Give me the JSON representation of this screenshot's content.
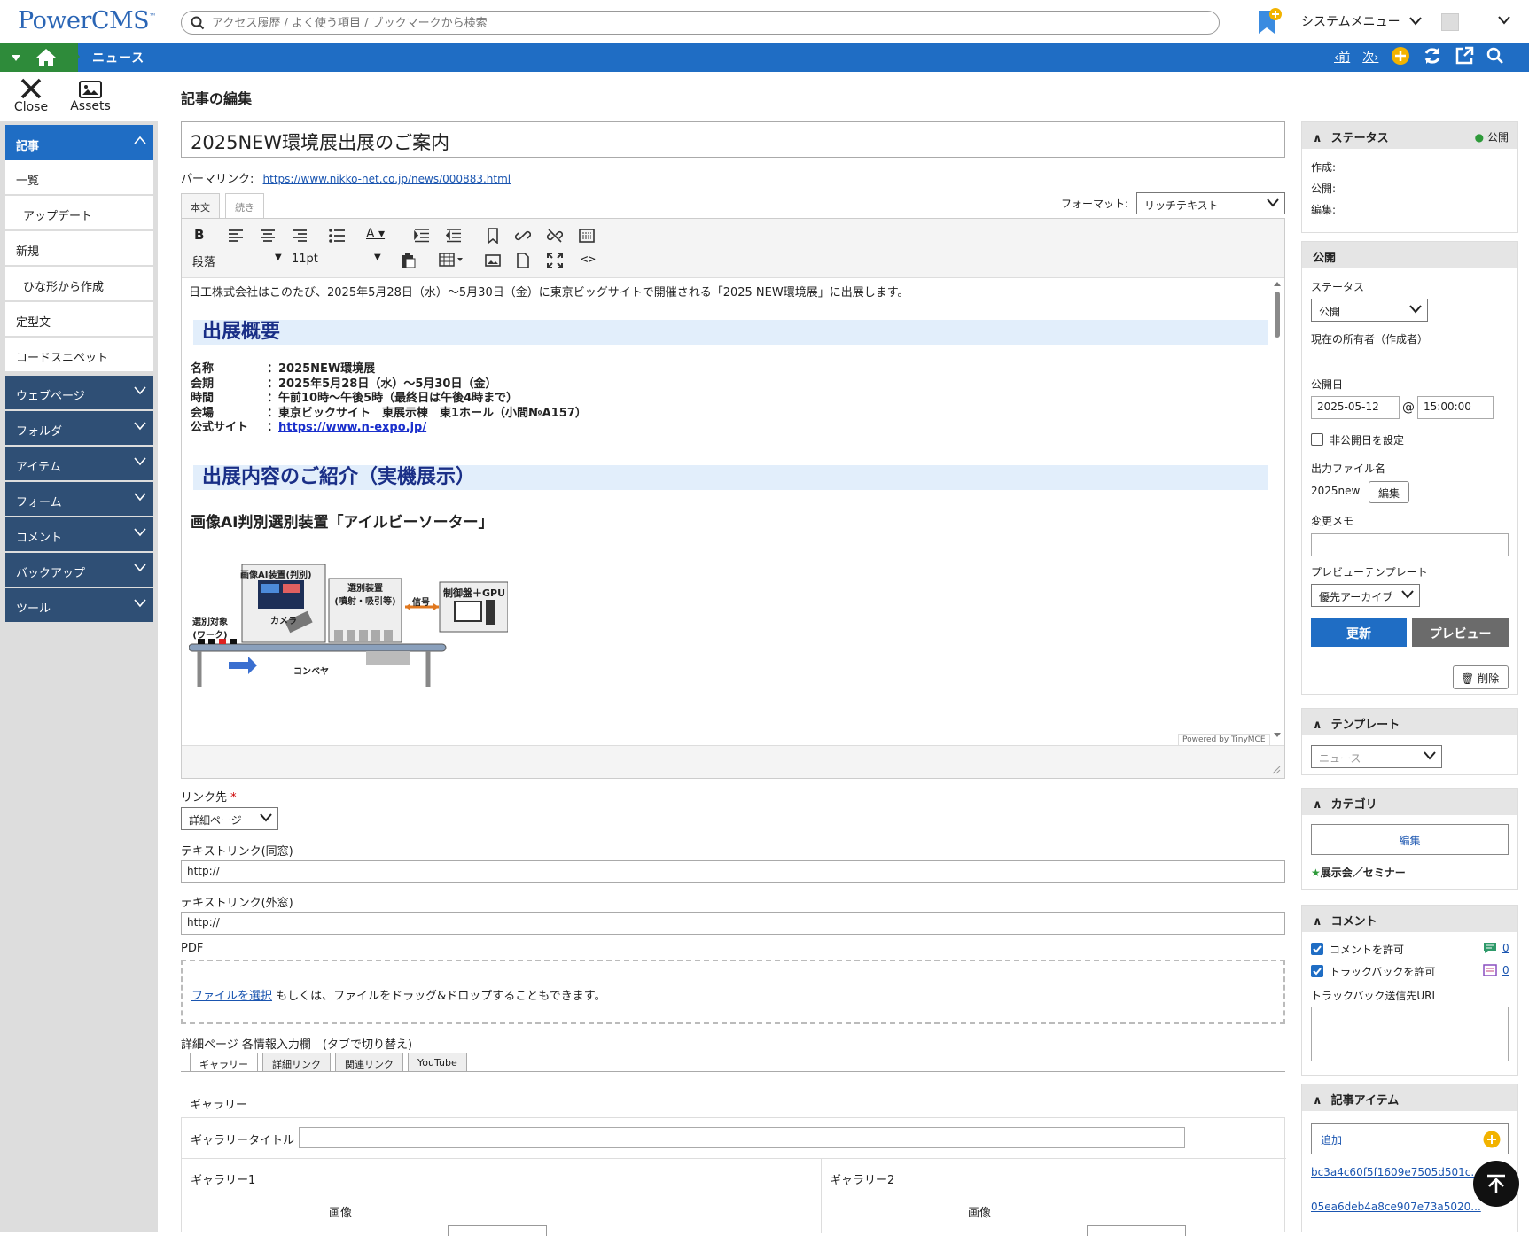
{
  "app": {
    "logo": "PowerCMS",
    "logo_tm": "™"
  },
  "search": {
    "placeholder": "アクセス履歴 / よく使う項目 / ブックマークから検索"
  },
  "header": {
    "system_menu": "システムメニュー"
  },
  "nav": {
    "breadcrumb": "ニュース",
    "prev": "‹前",
    "next": "次›"
  },
  "tools": {
    "close": "Close",
    "assets": "Assets"
  },
  "sidebar": {
    "active_section": "記事",
    "items": [
      "一覧",
      "アップデート",
      "新規",
      "ひな形から作成",
      "定型文",
      "コードスニペット"
    ],
    "sections": [
      "ウェブページ",
      "フォルダ",
      "アイテム",
      "フォーム",
      "コメント",
      "バックアップ",
      "ツール"
    ]
  },
  "page": {
    "title": "記事の編集"
  },
  "entry": {
    "title": "2025NEW環境展出展のご案内",
    "permalink_label": "パーマリンク:",
    "permalink": "https://www.nikko-net.co.jp/news/000883.html"
  },
  "editor": {
    "tabs": [
      "本文",
      "続き"
    ],
    "format_label": "フォーマット:",
    "format_value": "リッチテキスト",
    "block_select": "段落",
    "font_size": "11pt",
    "intro": "日工株式会社はこのたび、2025年5月28日（水）〜5月30日（金）に東京ビッグサイトで開催される「2025 NEW環境展」に出展します。",
    "h2_1": "出展概要",
    "info_labels": [
      "名称",
      "会期",
      "時間",
      "会場",
      "公式サイト"
    ],
    "info_values": [
      "：2025NEW環境展",
      "：2025年5月28日（水）〜5月30日（金）",
      "：午前10時〜午後5時（最終日は午後4時まで）",
      "：東京ビックサイト　東展示棟　東1ホール（小間№A157）",
      "："
    ],
    "info_link": "https://www.n-expo.jp/",
    "h2_2": "出展内容のご紹介（実機展示）",
    "h3": "画像AI判別選別装置「アイルビーソーター」",
    "diagram_labels": {
      "ai": "画像AI装置(判別)",
      "camera": "カメラ",
      "sorter": "選別装置\n(噴射・吸引等)",
      "signal": "信号",
      "control": "制御盤＋GPU",
      "target": "選別対象\n(ワーク)",
      "conveyor": "コンベヤ"
    },
    "powered": "Powered by TinyMCE"
  },
  "link": {
    "label": "リンク先",
    "required": "*",
    "value": "詳細ページ",
    "text_same_label": "テキストリンク(同窓)",
    "text_same_value": "http://",
    "text_new_label": "テキストリンク(外窓)",
    "text_new_value": "http://"
  },
  "pdf": {
    "label": "PDF",
    "choose": "ファイルを選択",
    "drop_text": " もしくは、ファイルをドラッグ&ドロップすることもできます。"
  },
  "detail": {
    "label": "詳細ページ 各情報入力欄　(タブで切り替え)",
    "tabs": [
      "ギャラリー",
      "詳細リンク",
      "関連リンク",
      "YouTube"
    ],
    "gallery_heading": "ギャラリー",
    "gallery_title_label": "ギャラリータイトル",
    "g1": "ギャラリー1",
    "g2": "ギャラリー2",
    "image_label": "画像"
  },
  "status_panel": {
    "title": "ステータス",
    "badge": "公開",
    "created": "作成:",
    "published": "公開:",
    "edited": "編集:"
  },
  "publish_panel": {
    "title": "公開",
    "status_label": "ステータス",
    "status_value": "公開",
    "owner": "現在の所有者（作成者）",
    "date_label": "公開日",
    "date": "2025-05-12",
    "at": "@",
    "time": "15:00:00",
    "unpublish": "非公開日を設定",
    "file_label": "出力ファイル名",
    "file_value": "2025new",
    "file_edit": "編集",
    "memo_label": "変更メモ",
    "preview_tpl_label": "プレビューテンプレート",
    "preview_tpl_value": "優先アーカイブ",
    "update": "更新",
    "preview": "プレビュー",
    "delete": "削除"
  },
  "template_panel": {
    "title": "テンプレート",
    "value": "ニュース"
  },
  "category_panel": {
    "title": "カテゴリ",
    "edit": "編集",
    "category": "展示会／セミナー"
  },
  "comment_panel": {
    "title": "コメント",
    "allow_comment": "コメントを許可",
    "comment_count": "0",
    "allow_tb": "トラックバックを許可",
    "tb_count": "0",
    "tb_url_label": "トラックバック送信先URL"
  },
  "items_panel": {
    "title": "記事アイテム",
    "add": "追加",
    "items": [
      "bc3a4c60f5f1609e7505d501c...",
      "05ea6deb4a8ce907e73a5020..."
    ]
  },
  "colors": {
    "primary": "#1f6dc4",
    "home": "#2e8b3a",
    "sidebar_section": "#2f4f75",
    "heading": "#1a2f87"
  }
}
